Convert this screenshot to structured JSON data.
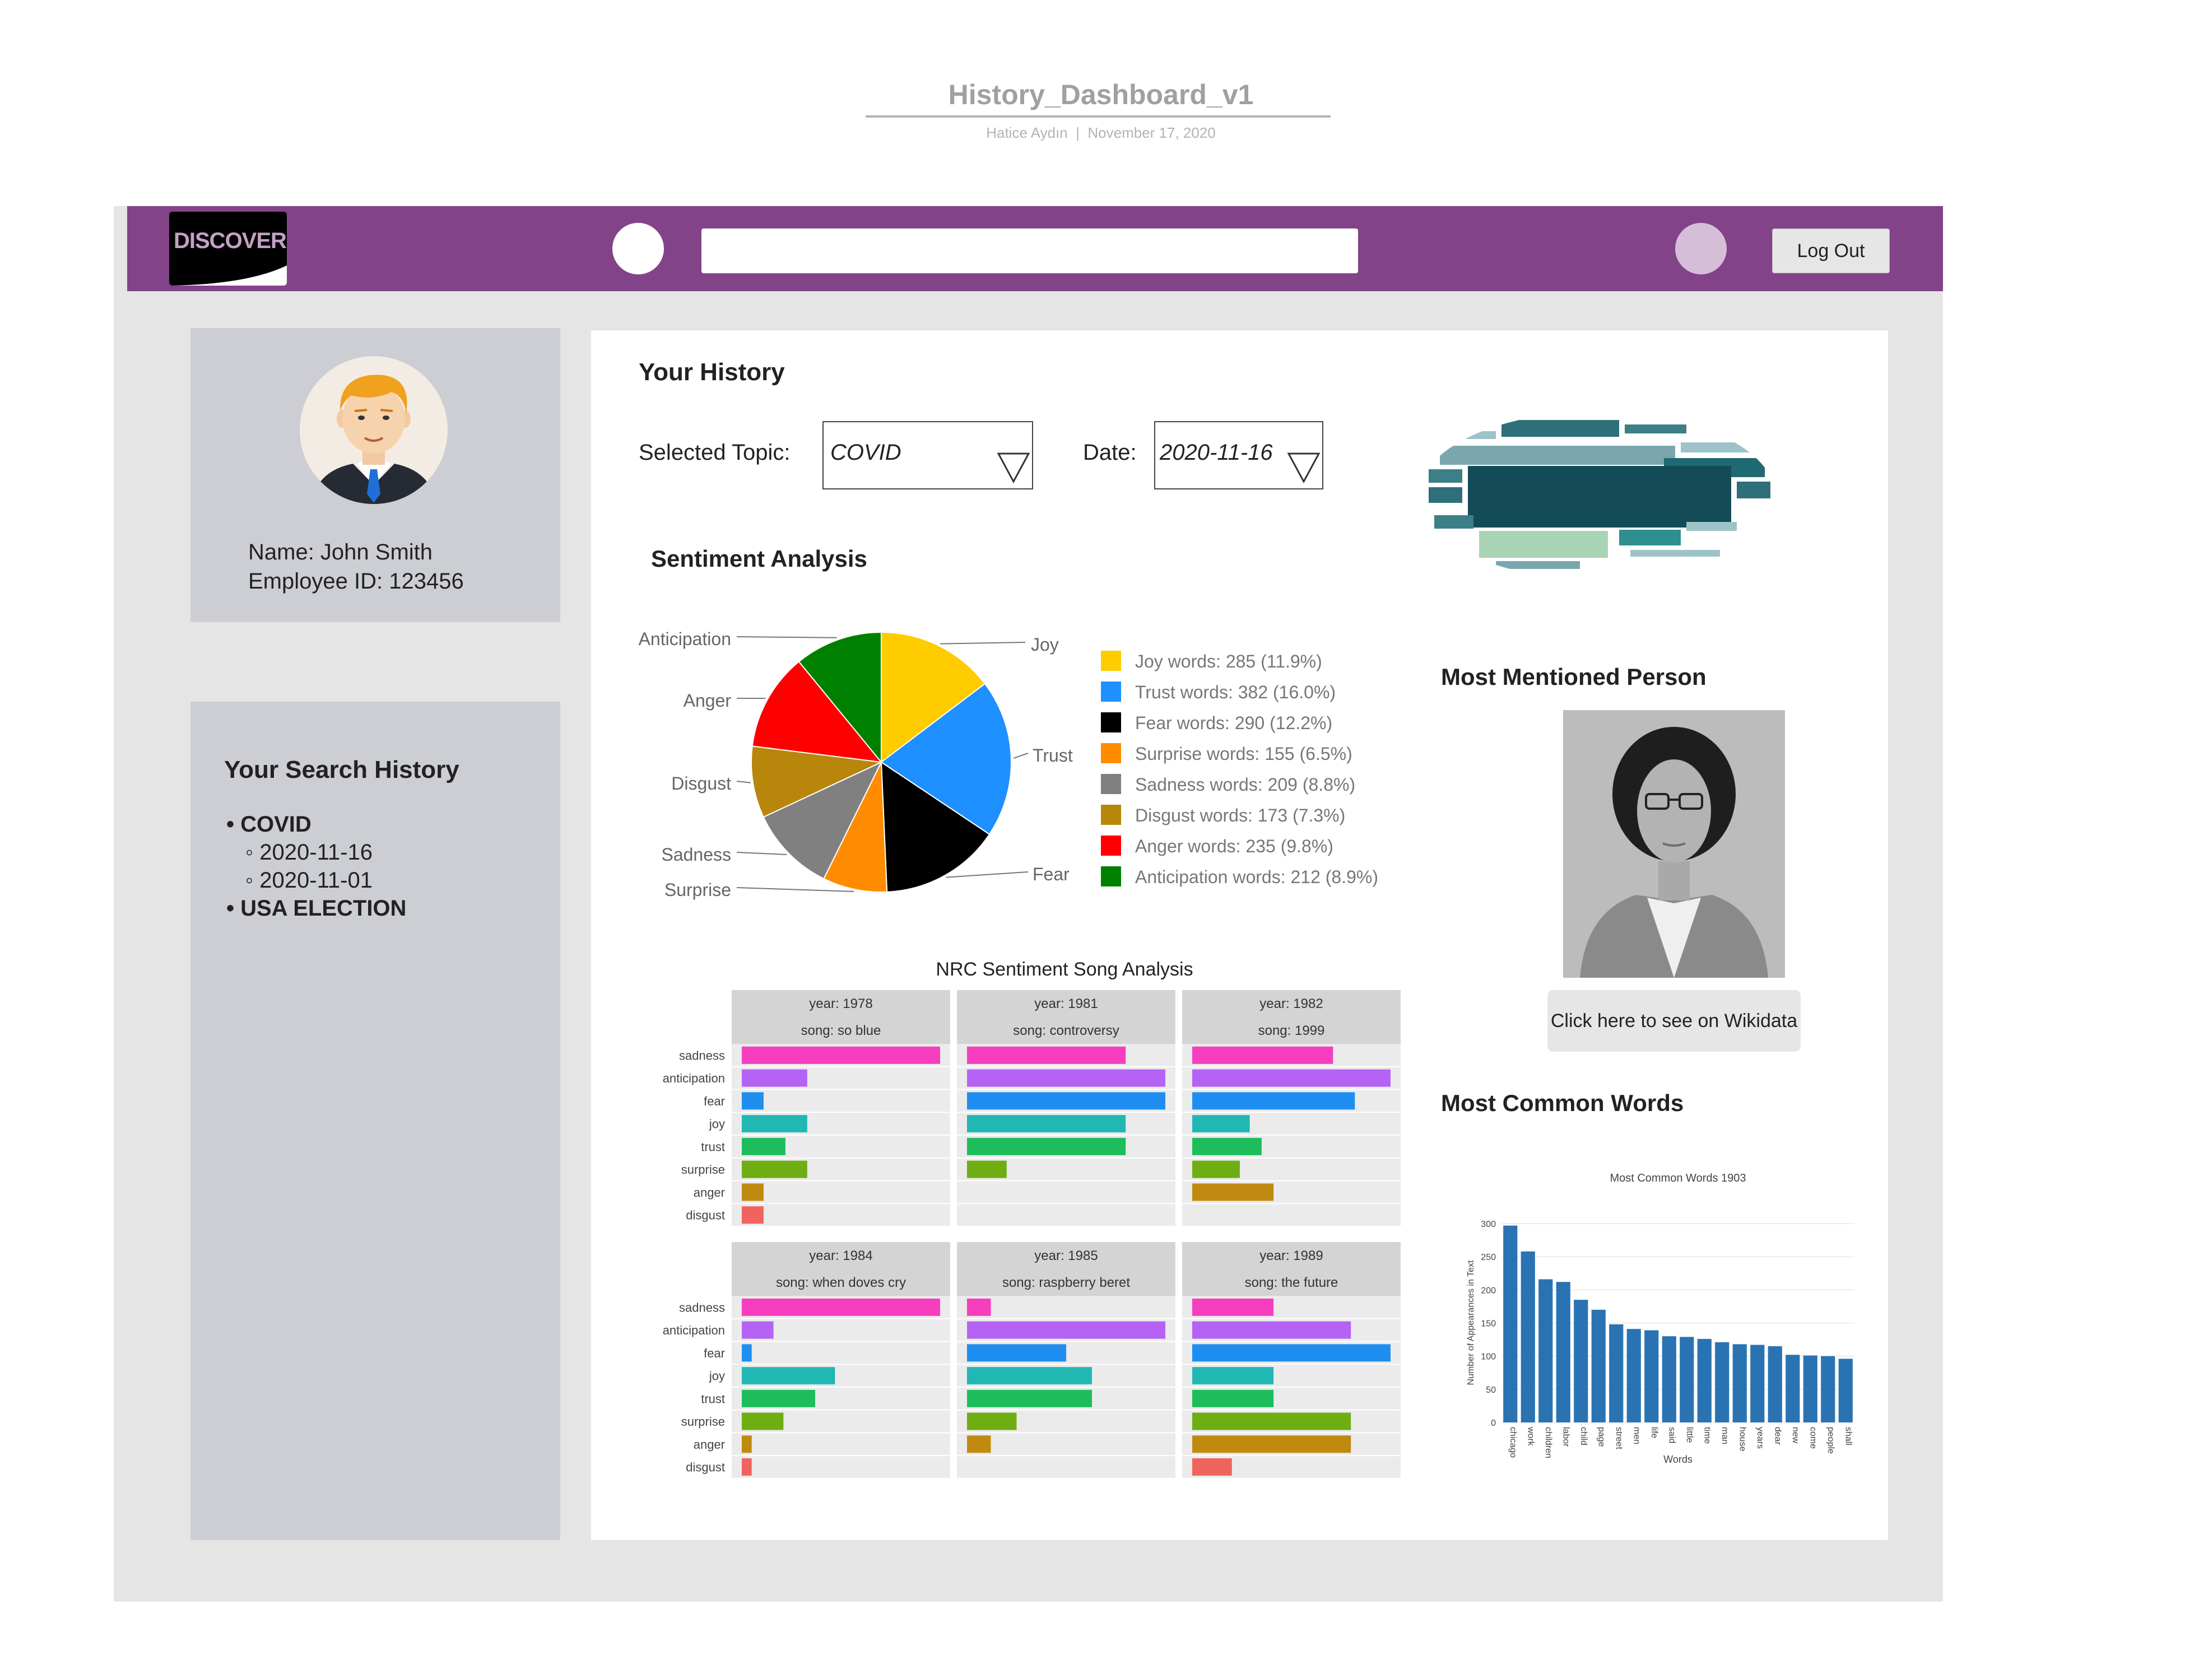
{
  "document": {
    "title": "History_Dashboard_v1",
    "author": "Hatice Aydın",
    "separator": "|",
    "date": "November 17, 2020"
  },
  "header": {
    "logo_text": "DISCOVER",
    "logout_label": "Log Out"
  },
  "profile": {
    "name": "Name: John Smith",
    "employee_id": "Employee ID: 123456"
  },
  "search_history": {
    "title": "Your Search History",
    "items": [
      {
        "label": "• COVID",
        "children": [
          "◦ 2020-11-16",
          "◦ 2020-11-01"
        ]
      },
      {
        "label": "• USA ELECTION",
        "children": []
      }
    ]
  },
  "main": {
    "title": "Your History",
    "topic_label": "Selected Topic:",
    "topic_value": "COVID",
    "date_label": "Date:",
    "date_value": "2020-11-16",
    "sentiment_title": "Sentiment Analysis",
    "most_mentioned_title": "Most Mentioned Person",
    "wikidata_label": "Click here to see on Wikidata",
    "common_words_title": "Most Common Words"
  },
  "chart_data": [
    {
      "type": "pie",
      "title": "",
      "slices": [
        {
          "label": "Joy",
          "legend": "Joy words: 285 (11.9%)",
          "value": 285,
          "color": "#ffcc00"
        },
        {
          "label": "Trust",
          "legend": "Trust words: 382 (16.0%)",
          "value": 382,
          "color": "#1e90ff"
        },
        {
          "label": "Fear",
          "legend": "Fear words: 290 (12.2%)",
          "value": 290,
          "color": "#000000"
        },
        {
          "label": "Surprise",
          "legend": "Surprise words: 155 (6.5%)",
          "value": 155,
          "color": "#ff8c00"
        },
        {
          "label": "Sadness",
          "legend": "Sadness words: 209 (8.8%)",
          "value": 209,
          "color": "#808080"
        },
        {
          "label": "Disgust",
          "legend": "Disgust words: 173 (7.3%)",
          "value": 173,
          "color": "#b8860b"
        },
        {
          "label": "Anger",
          "legend": "Anger words: 235 (9.8%)",
          "value": 235,
          "color": "#ff0000"
        },
        {
          "label": "Anticipation",
          "legend": "Anticipation words: 212 (8.9%)",
          "value": 212,
          "color": "#008000"
        }
      ]
    },
    {
      "type": "bar",
      "title": "NRC Sentiment Song Analysis",
      "categories": [
        "sadness",
        "anticipation",
        "fear",
        "joy",
        "trust",
        "surprise",
        "anger",
        "disgust"
      ],
      "colors": [
        "#f53fbf",
        "#b463f5",
        "#1e8ff0",
        "#21b8b4",
        "#1ebd5b",
        "#6fae12",
        "#c08a10",
        "#f0645e"
      ],
      "xlim": [
        0,
        1
      ],
      "panels": [
        {
          "year": "year: 1978",
          "song": "song: so blue",
          "values": [
            1.0,
            0.33,
            0.11,
            0.33,
            0.22,
            0.33,
            0.11,
            0.11
          ]
        },
        {
          "year": "year: 1981",
          "song": "song: controversy",
          "values": [
            0.8,
            1.0,
            1.0,
            0.8,
            0.8,
            0.2,
            0.0,
            0.0
          ]
        },
        {
          "year": "year: 1982",
          "song": "song: 1999",
          "values": [
            0.71,
            1.0,
            0.82,
            0.29,
            0.35,
            0.24,
            0.41,
            0.0
          ]
        },
        {
          "year": "year: 1984",
          "song": "song: when doves cry",
          "values": [
            1.0,
            0.16,
            0.05,
            0.47,
            0.37,
            0.21,
            0.05,
            0.05
          ]
        },
        {
          "year": "year: 1985",
          "song": "song: raspberry beret",
          "values": [
            0.12,
            1.0,
            0.5,
            0.63,
            0.63,
            0.25,
            0.12,
            0.0
          ]
        },
        {
          "year": "year: 1989",
          "song": "song: the future",
          "values": [
            0.41,
            0.8,
            1.0,
            0.41,
            0.41,
            0.8,
            0.8,
            0.2
          ]
        }
      ]
    },
    {
      "type": "bar",
      "title": "Most Common Words 1903",
      "xlabel": "Words",
      "ylabel": "Number of Appearances in Text",
      "ylim": [
        0,
        300
      ],
      "yticks": [
        0,
        50,
        100,
        150,
        200,
        250,
        300
      ],
      "categories": [
        "chicago",
        "work",
        "children",
        "labor",
        "child",
        "page",
        "street",
        "men",
        "life",
        "said",
        "little",
        "time",
        "man",
        "house",
        "years",
        "dear",
        "new",
        "come",
        "people",
        "shall"
      ],
      "values": [
        297,
        258,
        216,
        212,
        185,
        170,
        148,
        141,
        139,
        130,
        129,
        126,
        121,
        118,
        117,
        115,
        102,
        101,
        100,
        96
      ],
      "color": "#2a73b3"
    }
  ]
}
